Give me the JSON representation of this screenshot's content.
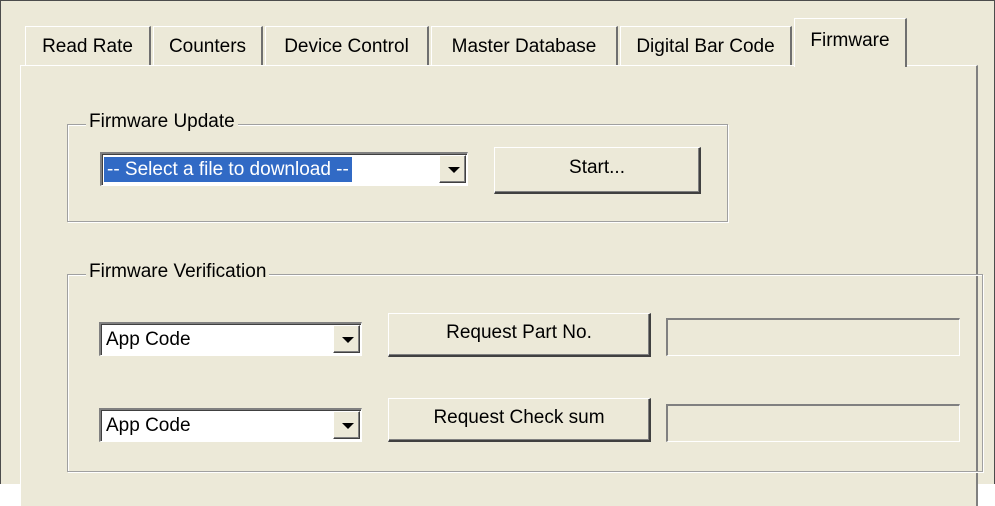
{
  "tabs": [
    {
      "label": "Read Rate",
      "active": false
    },
    {
      "label": "Counters",
      "active": false
    },
    {
      "label": "Device Control",
      "active": false
    },
    {
      "label": "Master Database",
      "active": false
    },
    {
      "label": "Digital Bar Code",
      "active": false
    },
    {
      "label": "Firmware",
      "active": true
    }
  ],
  "firmware_update": {
    "title": "Firmware Update",
    "file_select": {
      "value": "-- Select a file to download --"
    },
    "start_button": "Start..."
  },
  "firmware_verification": {
    "title": "Firmware Verification",
    "rows": [
      {
        "code_select": "App Code",
        "button": "Request Part No.",
        "result": ""
      },
      {
        "code_select": "App Code",
        "button": "Request Check sum",
        "result": ""
      }
    ]
  },
  "colors": {
    "panel_bg": "#ece9d8",
    "selection": "#316ac5"
  }
}
